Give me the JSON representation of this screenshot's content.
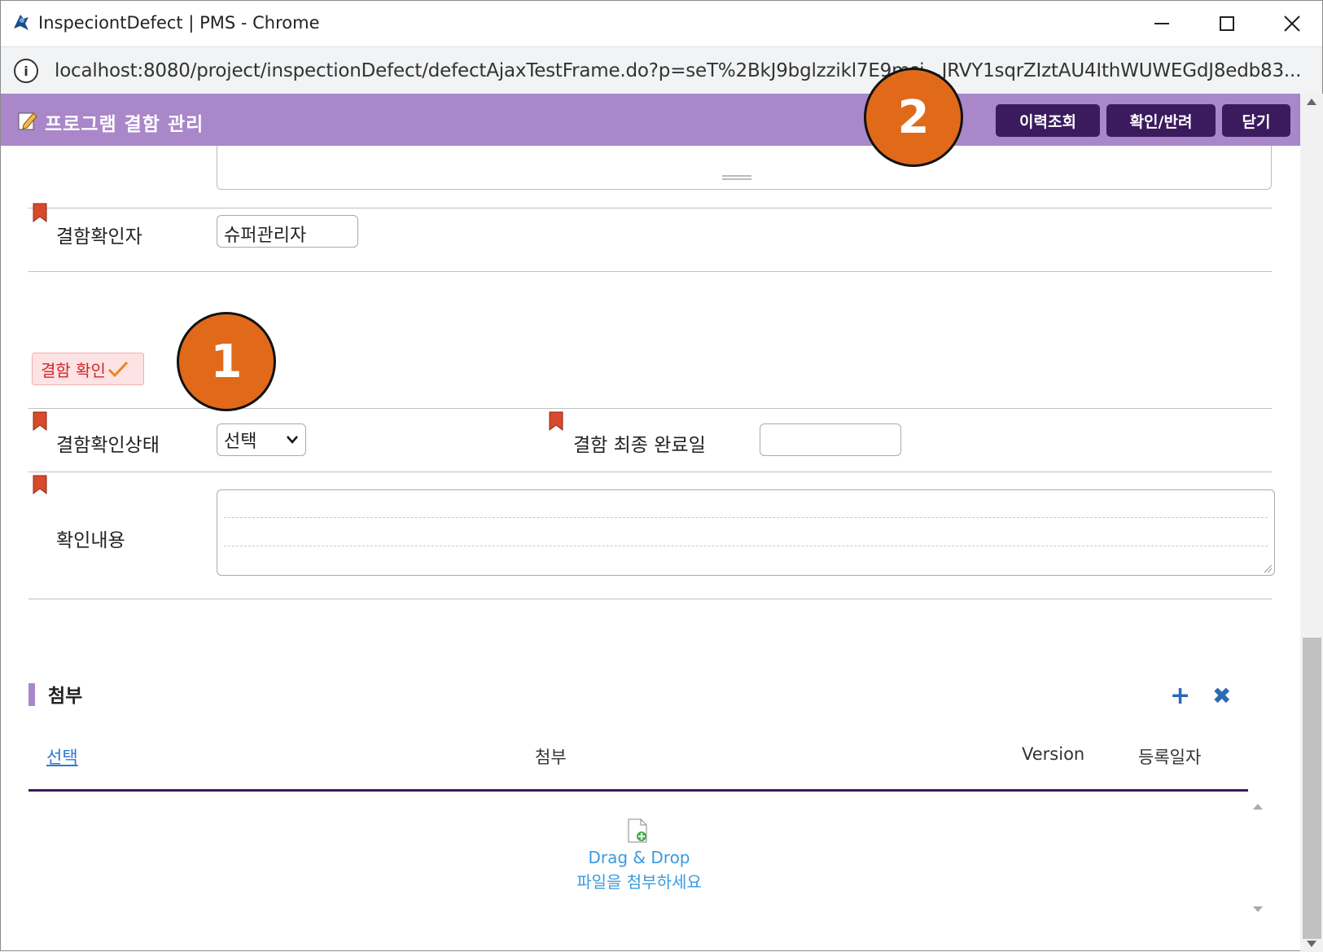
{
  "window": {
    "title": "InspeciontDefect | PMS - Chrome",
    "url": "localhost:8080/project/inspectionDefect/defectAjaxTestFrame.do?p=seT%2BkJ9bglzzikl7E9msj...JRVY1sqrZIztAU4IthWUWEGdJ8edb83..."
  },
  "header": {
    "title": "프로그램 결함 관리",
    "buttons": {
      "history": "이력조회",
      "confirm_return": "확인/반려",
      "close": "닫기"
    }
  },
  "markers": {
    "one": "1",
    "two": "2"
  },
  "form": {
    "confirmer_label": "결함확인자",
    "confirmer_value": "슈퍼관리자",
    "section_badge": "결함 확인",
    "status_label": "결함확인상태",
    "status_value": "선택",
    "final_date_label": "결함 최종 완료일",
    "final_date_value": "",
    "content_label": "확인내용"
  },
  "attachment": {
    "title": "첨부",
    "columns": [
      "선택",
      "첨부",
      "Version",
      "등록일자"
    ],
    "drop_line1": "Drag & Drop",
    "drop_line2": "파일을 첨부하세요"
  },
  "colors": {
    "header_bg": "#a987c9",
    "button_bg": "#3b1a5e",
    "marker": "#e06a1a",
    "badge_text": "#d0262e",
    "link": "#3a9be0"
  }
}
